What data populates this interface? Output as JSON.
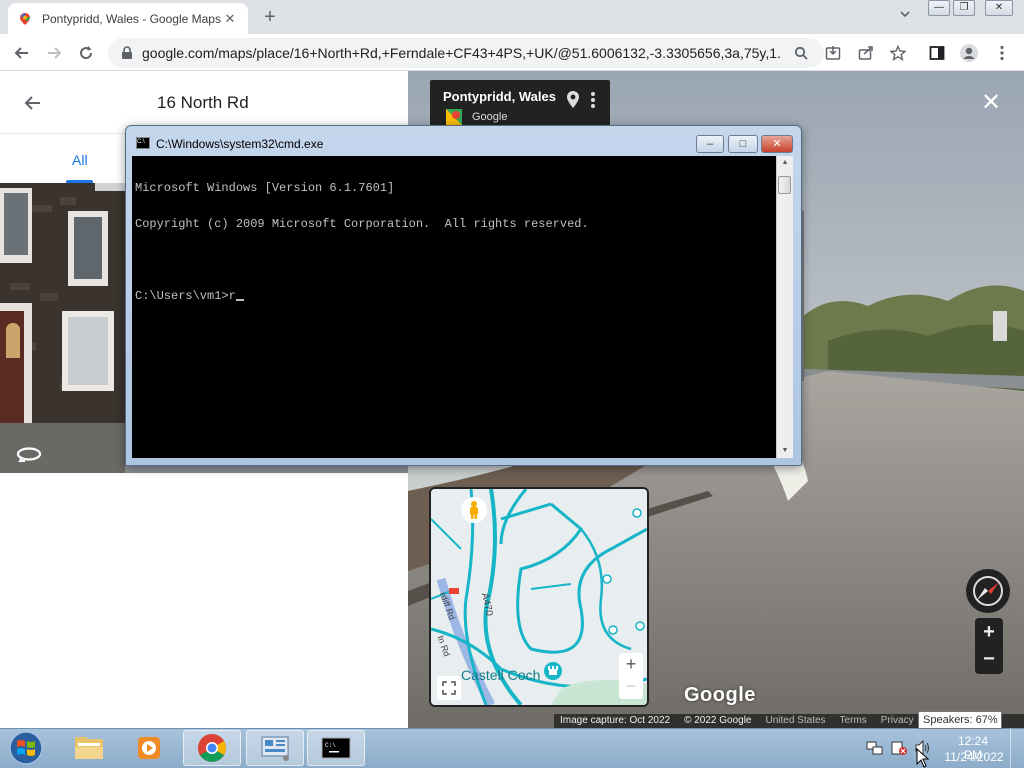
{
  "browser": {
    "tab_title": "Pontypridd, Wales - Google Maps",
    "url": "google.com/maps/place/16+North+Rd,+Ferndale+CF43+4PS,+UK/@51.6006132,-3.3305656,3a,75y,1..."
  },
  "maps": {
    "place_name": "16 North Rd",
    "tab_all": "All",
    "sv_title": "Pontypridd, Wales",
    "sv_sub": "Google",
    "logo": "Google",
    "attribution": {
      "capture": "Image capture: Oct 2022",
      "copyright": "© 2022 Google",
      "country": "United States",
      "terms": "Terms",
      "privacy": "Privacy"
    },
    "minimap": {
      "road_label": "A470",
      "place_label": "Castell Coch",
      "road2": "rdiff Rd",
      "road3": "In Rd"
    }
  },
  "cmd": {
    "title": "C:\\Windows\\system32\\cmd.exe",
    "lines": [
      "Microsoft Windows [Version 6.1.7601]",
      "Copyright (c) 2009 Microsoft Corporation.  All rights reserved.",
      "",
      "C:\\Users\\vm1>r"
    ]
  },
  "taskbar": {
    "time": "12:24 PM",
    "date": "11/24/2022",
    "speaker_tooltip": "Speakers: 67%"
  },
  "icons": {
    "maps_favicon": "google-maps-pin-icon",
    "chrome": "chrome-icon",
    "explorer": "folder-icon",
    "media": "media-player-icon",
    "control_panel": "control-panel-icon",
    "cmd": "cmd-icon"
  }
}
